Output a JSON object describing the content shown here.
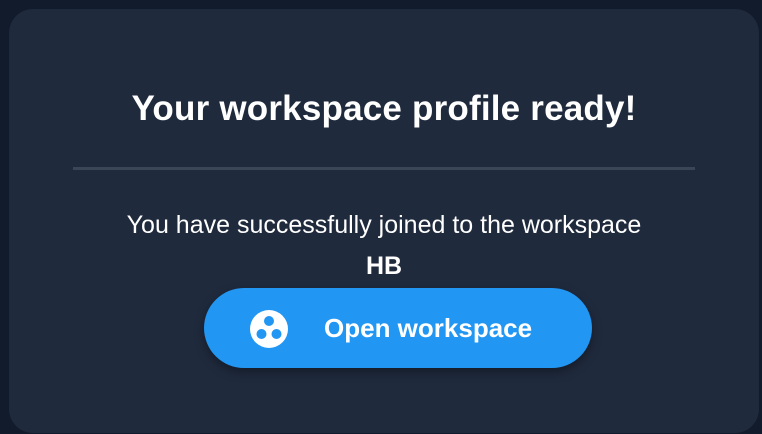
{
  "dialog": {
    "title": "Your workspace profile ready!",
    "message": "You have successfully joined to the workspace",
    "workspace_name": "HB",
    "open_button_label": "Open workspace",
    "open_button_icon": "workspace-icon"
  },
  "colors": {
    "background": "#121b2b",
    "card": "#1f2a3d",
    "divider": "#3a4556",
    "accent": "#2196f3",
    "text": "#ffffff"
  }
}
